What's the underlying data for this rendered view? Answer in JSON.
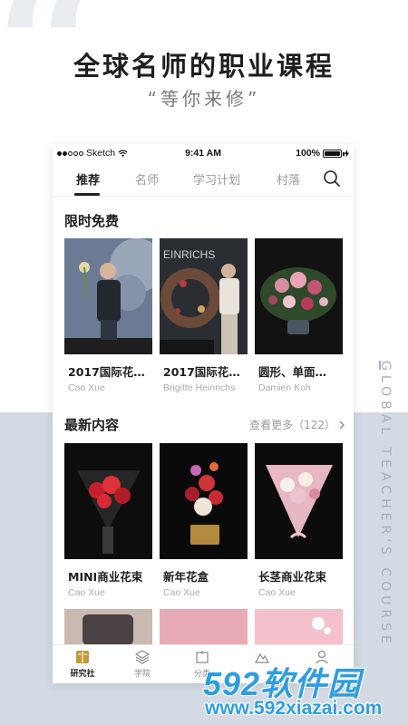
{
  "promo": {
    "headline": "全球名师的职业课程",
    "subline": "“等你来修”",
    "vertical_text": "GLOBAL TEACHER'S COURSE"
  },
  "statusbar": {
    "carrier": "Sketch",
    "time": "9:41 AM",
    "battery": "100%",
    "battery_level": 1.0
  },
  "tabs": [
    {
      "label": "推荐",
      "active": true
    },
    {
      "label": "名师",
      "active": false
    },
    {
      "label": "学习计划",
      "active": false
    },
    {
      "label": "村落",
      "active": false
    }
  ],
  "sections": {
    "free": {
      "title": "限时免费"
    },
    "latest": {
      "title": "最新内容",
      "more": "查看更多（122）"
    }
  },
  "free_cards": [
    {
      "title": "2017国际花…",
      "author": "Cao Xue"
    },
    {
      "title": "2017国际花…",
      "author": "Brigitte Heinrichs"
    },
    {
      "title": "圆形、单面…",
      "author": "Damien Koh"
    }
  ],
  "latest_cards": [
    {
      "title": "MINI商业花束",
      "author": "Cao Xue"
    },
    {
      "title": "新年花盒",
      "author": "Cao Xue"
    },
    {
      "title": "长茎商业花束",
      "author": "Cao Xue"
    }
  ],
  "thumb_texts": {
    "heinrichs_sign": "EINRICHS"
  },
  "bottomnav": [
    {
      "label": "研究社",
      "icon": "book-icon",
      "active": true
    },
    {
      "label": "学院",
      "icon": "layers-icon",
      "active": false
    },
    {
      "label": "分类",
      "icon": "category-icon",
      "active": false
    },
    {
      "label": "",
      "icon": "mountain-icon",
      "active": false
    },
    {
      "label": "",
      "icon": "user-icon",
      "active": false
    }
  ],
  "watermark": {
    "logo": "592软件园",
    "url": "www.592xiazai.com"
  },
  "colors": {
    "accent": "#222222",
    "muted": "#999999",
    "lower_bg": "#d3dae3",
    "watermark": "#2f9de0"
  }
}
